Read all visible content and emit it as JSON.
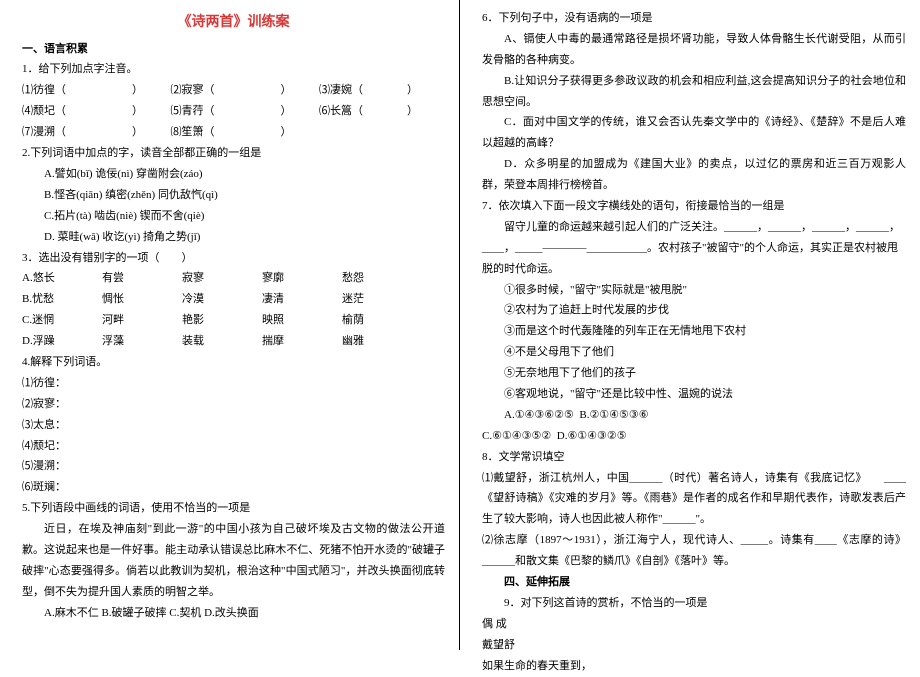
{
  "title": "《诗两首》训练案",
  "sec1_head": "一、语言积累",
  "q1": "1．给下列加点字注音。",
  "q1_items": [
    "⑴彷徨（　　　　　　）　　　⑵寂寥（　　　　　　）　　　⑶凄婉（　　　　）",
    "⑷颓圮（　　　　　　）　　　⑸青荇（　　　　　　）　　　⑹长篙（　　　　）",
    "⑺漫溯（　　　　　　）　　　⑻笙箫（　　　　　　）"
  ],
  "q2": "2.下列词语中加点的字，读音全部都正确的一组是",
  "q2_opts": [
    "A.譬如(bǐ)  诡佞(nì)  穿凿附会(záo)",
    "B.悭吝(qiān)  缜密(zhěn)  同仇敌忾(qì)",
    "C.拓片(tà)  啮齿(niè)  锲而不舍(qiè)",
    "D. 菜畦(wā) 收讫(yì)  掎角之势(jǐ)"
  ],
  "q3": "3．选出没有错别字的一项（　　）",
  "q3_rows": [
    [
      "A.悠长",
      "有尝",
      "寂寥",
      "寥廓",
      "愁怨"
    ],
    [
      "B.忧愁",
      "惆怅",
      "冷漠",
      "凄清",
      "迷茫"
    ],
    [
      "C.迷惘",
      "河畔",
      "艳影",
      "映照",
      "榆荫"
    ],
    [
      "D.浮躁",
      "浮藻",
      "装载",
      "揣摩",
      "幽雅"
    ]
  ],
  "q4": "4.解释下列词语。",
  "q4_items": [
    "⑴彷徨：",
    "⑵寂寥：",
    "⑶太息：",
    "⑷颓圮：",
    "⑸漫溯：",
    "⑹斑斓："
  ],
  "q5": "5.下列语段中画线的词语，使用不恰当的一项是",
  "q5_body": "近日，在埃及神庙刻\"到此一游\"的中国小孩为自己破坏埃及古文物的做法公开道歉。这说起来也是一件好事。能主动承认错误总比麻木不仁、死猪不怕开水烫的\"破罐子破摔\"心态要强得多。倘若以此教训为契机，根治这种\"中国式陋习\"，并改头换面彻底转型，倒不失为提升国人素质的明智之举。",
  "q5_opts": "A.麻木不仁  B.破罐子破摔  C.契机  D.改头换面",
  "q6": "6．下列句子中，没有语病的一项是",
  "q6_opts": [
    "A、镉使人中毒的最通常路径是损坏肾功能，导致人体骨骼生长代谢受阻，从而引发骨骼的各种病变。",
    "B.让知识分子获得更多参政议政的机会和相应利益,这会提高知识分子的社会地位和思想空间。",
    "C．面对中国文学的传统，谁又会否认先秦文学中的《诗经》、《楚辞》不是后人难以超越的高峰？",
    "D．众多明星的加盟成为《建国大业》的卖点，以过亿的票房和近三百万观影人群，荣登本周排行榜榜首。"
  ],
  "q7": "7．依次填入下面一段文字横线处的语句，衔接最恰当的一组是",
  "q7_body_a": "留守儿童的命运越来越引起人们的广泛关注。______，______，______，______，",
  "q7_body_b": "____，_____————___________。农村孩子\"被留守\"的个人命运，其实正是农村被甩脱的时代命运。",
  "q7_list": [
    "①很多时候，\"留守\"实际就是\"被甩脱\"",
    "②农村为了追赶上时代发展的步伐",
    "③而是这个时代轰隆隆的列车正在无情地甩下农村",
    "④不是父母甩下了他们",
    "⑤无奈地甩下了他们的孩子",
    "⑥客观地说，\"留守\"还是比较中性、温婉的说法"
  ],
  "q7_opts": "A.①④③⑥②⑤  B.②①④⑤③⑥\nC.⑥①④③⑤②  D.⑥①④③②⑤",
  "q8": "8．文学常识填空",
  "q8_items": [
    "⑴戴望舒，浙江杭州人，中国______（时代）著名诗人，诗集有《我底记忆》　　____《望舒诗稿》《灾难的岁月》等。《雨巷》是作者的成名作和早期代表作，诗歌发表后产生了较大影响，诗人也因此被人称作\"______\"。",
    "⑵徐志摩（1897～1931），浙江海宁人，现代诗人、_____。诗集有____《志摩的诗》______和散文集《巴黎的鳞爪》《自剖》《落叶》等。"
  ],
  "sec4_head": "四、延伸拓展",
  "q9": "9．对下列这首诗的赏析，不恰当的一项是",
  "q9_title": "偶 成",
  "q9_author": "戴望舒",
  "q9_line": "如果生命的春天重到，"
}
